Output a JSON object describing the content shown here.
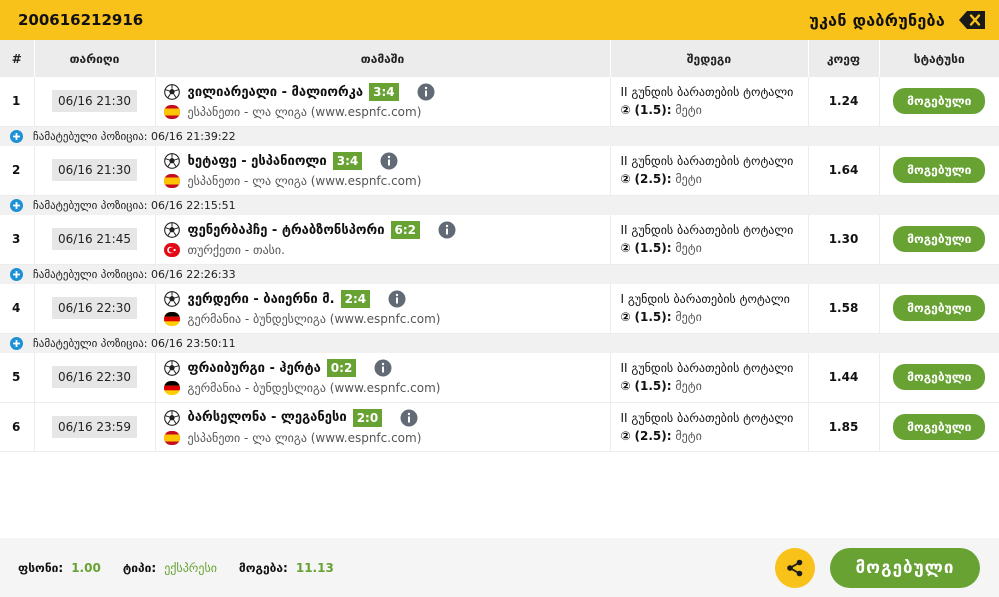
{
  "header": {
    "ticket_id": "200616212916",
    "back_label": "უკან დაბრუნება"
  },
  "table": {
    "columns": [
      "#",
      "თარიღი",
      "თამაში",
      "შედეგი",
      "კოეფ",
      "სტატუსი"
    ],
    "rows": [
      {
        "num": "1",
        "date": "06/16 21:30",
        "teams": "ვილიარეალი - მალიორკა",
        "score": "3:4",
        "flag": "es",
        "league": "ესპანეთი - ლა ლიგა (www.espnfc.com)",
        "result_line1": "II გუნდის ბარათების ტოტალი",
        "result_sym": "②",
        "result_value": "(1.5):",
        "result_side": "მეტი",
        "odds": "1.24",
        "status": "მოგებული"
      },
      {
        "num": "2",
        "date": "06/16 21:30",
        "teams": "ხეტაფე - ესპანიოლი",
        "score": "3:4",
        "flag": "es",
        "league": "ესპანეთი - ლა ლიგა (www.espnfc.com)",
        "result_line1": "II გუნდის ბარათების ტოტალი",
        "result_sym": "②",
        "result_value": "(2.5):",
        "result_side": "მეტი",
        "odds": "1.64",
        "status": "მოგებული"
      },
      {
        "num": "3",
        "date": "06/16 21:45",
        "teams": "ფენერბაჰჩე - ტრაბზონსპორი",
        "score": "6:2",
        "flag": "tr",
        "league": "თურქეთი - თასი.",
        "result_line1": "II გუნდის ბარათების ტოტალი",
        "result_sym": "②",
        "result_value": "(1.5):",
        "result_side": "მეტი",
        "odds": "1.30",
        "status": "მოგებული"
      },
      {
        "num": "4",
        "date": "06/16 22:30",
        "teams": "ვერდერი - ბაიერნი მ.",
        "score": "2:4",
        "flag": "de",
        "league": "გერმანია - ბუნდესლიგა (www.espnfc.com)",
        "result_line1": "I გუნდის ბარათების ტოტალი",
        "result_sym": "②",
        "result_value": "(1.5):",
        "result_side": "მეტი",
        "odds": "1.58",
        "status": "მოგებული"
      },
      {
        "num": "5",
        "date": "06/16 22:30",
        "teams": "ფრაიბურგი - ჰერტა",
        "score": "0:2",
        "flag": "de",
        "league": "გერმანია - ბუნდესლიგა (www.espnfc.com)",
        "result_line1": "II გუნდის ბარათების ტოტალი",
        "result_sym": "②",
        "result_value": "(1.5):",
        "result_side": "მეტი",
        "odds": "1.44",
        "status": "მოგებული"
      },
      {
        "num": "6",
        "date": "06/16 23:59",
        "teams": "ბარსელონა - ლეგანესი",
        "score": "2:0",
        "flag": "es",
        "league": "ესპანეთი - ლა ლიგა (www.espnfc.com)",
        "result_line1": "II გუნდის ბარათების ტოტალი",
        "result_sym": "②",
        "result_value": "(2.5):",
        "result_side": "მეტი",
        "odds": "1.85",
        "status": "მოგებული"
      }
    ],
    "positions": [
      {
        "label": "ჩამატებული პოზიცია:",
        "time": "06/16 21:39:22"
      },
      {
        "label": "ჩამატებული პოზიცია:",
        "time": "06/16 22:15:51"
      },
      {
        "label": "ჩამატებული პოზიცია:",
        "time": "06/16 22:26:33"
      },
      {
        "label": "ჩამატებული პოზიცია:",
        "time": "06/16 23:50:11"
      }
    ]
  },
  "footer": {
    "stake_label": "ფსონი:",
    "stake_value": "1.00",
    "type_label": "ტიპი:",
    "type_value": "ექსპრესი",
    "win_label": "მოგება:",
    "win_value": "11.13",
    "won_button": "მოგებული"
  },
  "colors": {
    "accent_yellow": "#f8c21b",
    "won_green": "#68a233",
    "info_gray": "#616a75",
    "plus_blue": "#1e90d6"
  }
}
